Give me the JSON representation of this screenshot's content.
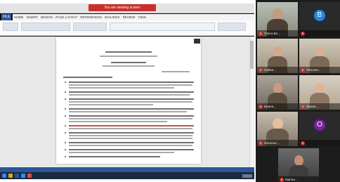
{
  "share": {
    "banner": "You are viewing screen"
  },
  "word": {
    "file_tab": "FILE",
    "tabs": [
      "HOME",
      "INSERT",
      "DESIGN",
      "PAGE LAYOUT",
      "REFERENCES",
      "MAILINGS",
      "REVIEW",
      "VIEW"
    ]
  },
  "participants": [
    {
      "name": "Ольга Бо…",
      "avatar": "",
      "color": "#4a3f35"
    },
    {
      "name": "",
      "avatar": "B",
      "color": "#1e88e5"
    },
    {
      "name": "Galina…",
      "avatar": "",
      "color": "#6b5a48"
    },
    {
      "name": "Татьяна…",
      "avatar": "",
      "color": "#7b6a58"
    },
    {
      "name": "Ирина…",
      "avatar": "",
      "color": "#5d4d3f"
    },
    {
      "name": "Лилия…",
      "avatar": "",
      "color": "#8b7763"
    },
    {
      "name": "Наталья…",
      "avatar": "",
      "color": "#6a5a4b"
    },
    {
      "name": "",
      "avatar": "О",
      "color": "#7b1fa2"
    },
    {
      "name": "Marina…",
      "avatar": "",
      "color": "#3d3d3d"
    }
  ]
}
